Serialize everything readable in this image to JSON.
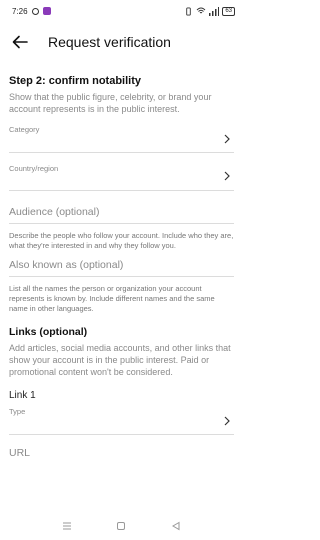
{
  "status_bar": {
    "time": "7:26",
    "battery": "63"
  },
  "header": {
    "title": "Request verification"
  },
  "step": {
    "title": "Step 2: confirm notability",
    "description": "Show that the public figure, celebrity, or brand your account represents is in the public interest."
  },
  "fields": {
    "category_label": "Category",
    "country_label": "Country/region",
    "audience_placeholder": "Audience (optional)",
    "audience_help": "Describe the people who follow your account. Include who they are, what they're interested in and why they follow you.",
    "aka_placeholder": "Also known as (optional)",
    "aka_help": "List all the names the person or organization your account represents is known by. Include different names and the same name in other languages."
  },
  "links": {
    "title": "Links (optional)",
    "description": "Add articles, social media accounts, and other links that show your account is in the public interest. Paid or promotional content won't be considered.",
    "link1_label": "Link 1",
    "type_label": "Type",
    "url_placeholder": "URL"
  },
  "icons": {
    "back": "back-arrow-icon",
    "chevron": "chevron-right-icon"
  }
}
